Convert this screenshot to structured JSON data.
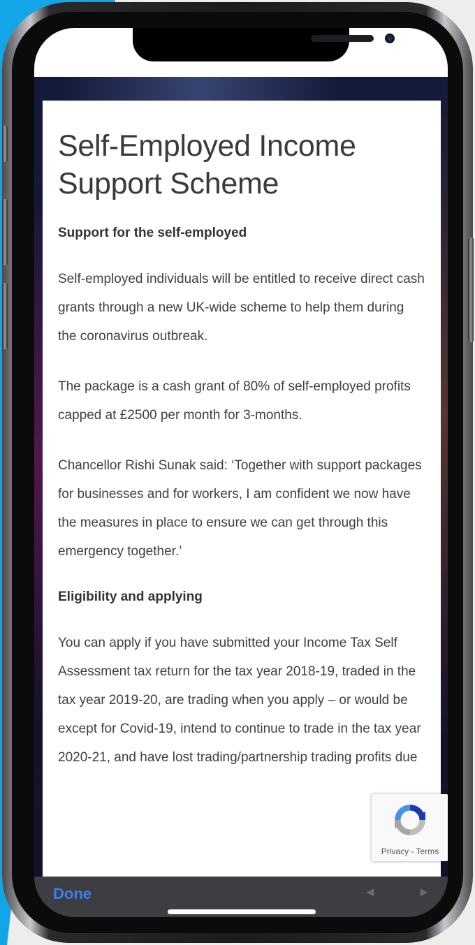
{
  "article": {
    "title": "Self-Employed Income Support Scheme",
    "heading1": "Support for the self-employed",
    "para1": "Self-employed individuals will be entitled to receive direct cash grants through a new UK-wide scheme to help them during the coronavirus outbreak.",
    "para2": "The package is a cash grant of 80% of self-employed profits capped at £2500 per month for 3-months.",
    "para3": "Chancellor Rishi Sunak said: ‘Together with support packages for businesses and for workers, I am confident we now have the measures in place to ensure we can get through this emergency together.’",
    "heading2": "Eligibility and applying",
    "para4": "You can apply if you have submitted your Income Tax Self Assessment tax return for the tax year 2018-19, traded in the tax year 2019-20, are trading when you apply – or would be except for Covid-19, intend to continue to trade in the tax year 2020-21, and have lost trading/partnership trading profits due"
  },
  "recaptcha": {
    "links": "Privacy - Terms",
    "icon": "recaptcha-icon"
  },
  "toolbar": {
    "done_label": "Done",
    "prev_glyph": "◄",
    "next_glyph": "►"
  },
  "colors": {
    "accent": "#3a7ee8",
    "toolbar_bg": "#3e3e42",
    "brand_blue": "#12a6e8"
  }
}
